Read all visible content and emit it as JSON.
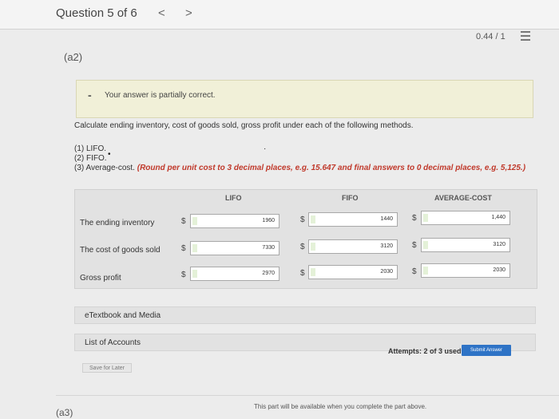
{
  "header": {
    "question_title": "Question 5 of 6",
    "prev": "<",
    "next": ">",
    "score": "0.44 / 1"
  },
  "part_label": "(a2)",
  "feedback": {
    "dash": "-",
    "text": "Your answer is partially correct."
  },
  "prompt": "Calculate ending inventory, cost of goods sold, gross profit under each of the following methods.",
  "items": {
    "item1": "(1) LIFO.",
    "item2": "(2) FIFO.",
    "item3_prefix": "(3) Average-cost.",
    "item3_instruction": "(Round per unit cost to 3 decimal places, e.g. 15.647 and final answers to 0 decimal places, e.g. 5,125.)"
  },
  "table": {
    "columns": [
      "LIFO",
      "FIFO",
      "AVERAGE-COST"
    ],
    "currency": "$",
    "rows": [
      {
        "label": "The ending inventory",
        "values": [
          "1960",
          "1440",
          "1,440"
        ]
      },
      {
        "label": "The cost of goods sold",
        "values": [
          "7330",
          "3120",
          "3120"
        ]
      },
      {
        "label": "Gross profit",
        "values": [
          "2970",
          "2030",
          "2030"
        ]
      }
    ]
  },
  "links": {
    "etextbook": "eTextbook and Media",
    "accounts": "List of Accounts"
  },
  "footer": {
    "attempts": "Attempts: 2 of 3 used",
    "submit": "Submit Answer",
    "save": "Save for Later",
    "next_part_label": "(a3)",
    "next_part_note": "This part will be available when you complete the part above."
  },
  "colors": {
    "accent": "#2e73c6",
    "feedback_bg": "#f1f0d8",
    "instruction_red": "#c0392b"
  }
}
